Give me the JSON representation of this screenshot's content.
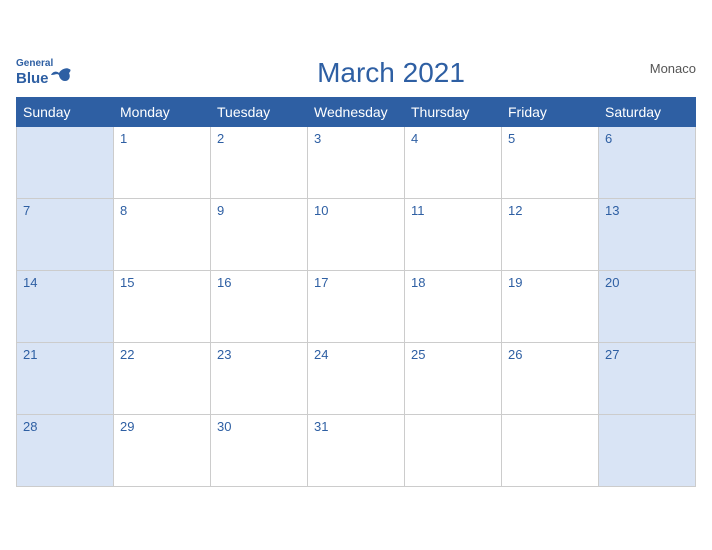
{
  "header": {
    "title": "March 2021",
    "country": "Monaco",
    "logo_general": "General",
    "logo_blue": "Blue"
  },
  "days_of_week": [
    "Sunday",
    "Monday",
    "Tuesday",
    "Wednesday",
    "Thursday",
    "Friday",
    "Saturday"
  ],
  "weeks": [
    [
      "",
      "1",
      "2",
      "3",
      "4",
      "5",
      "6"
    ],
    [
      "7",
      "8",
      "9",
      "10",
      "11",
      "12",
      "13"
    ],
    [
      "14",
      "15",
      "16",
      "17",
      "18",
      "19",
      "20"
    ],
    [
      "21",
      "22",
      "23",
      "24",
      "25",
      "26",
      "27"
    ],
    [
      "28",
      "29",
      "30",
      "31",
      "",
      "",
      ""
    ]
  ],
  "colors": {
    "header_bg": "#2e5fa3",
    "weekend_bg": "#d9e4f5",
    "text_blue": "#2e5fa3"
  }
}
